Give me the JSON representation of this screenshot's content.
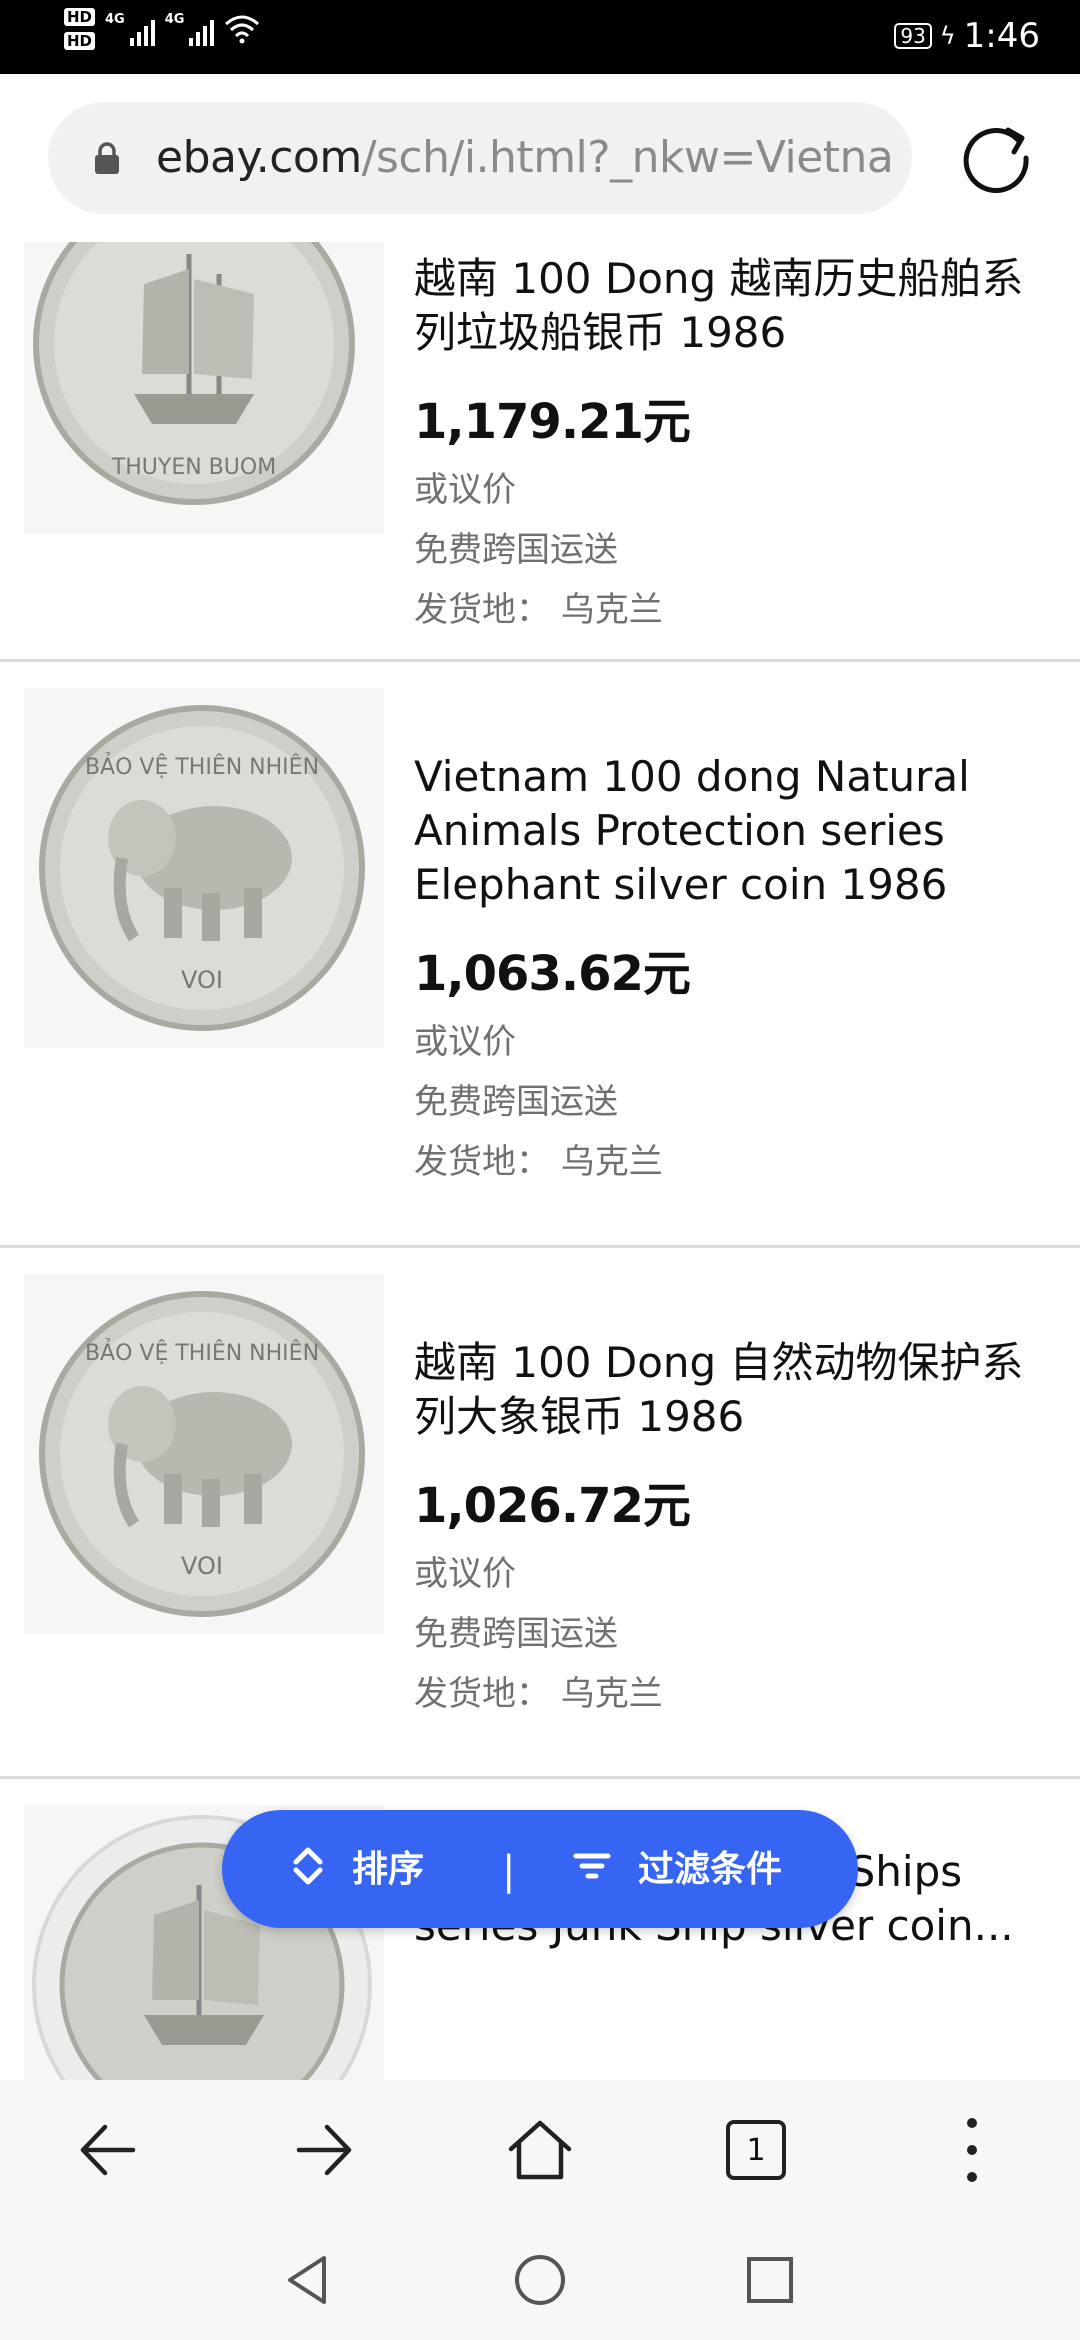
{
  "status_bar": {
    "hd1": "HD",
    "hd2": "HD",
    "net1": "4G",
    "net2": "4G",
    "battery": "93",
    "time": "1:46"
  },
  "url_bar": {
    "domain": "ebay.com",
    "path": "/sch/i.html?_nkw=Vietna"
  },
  "listings": [
    {
      "title": "越南 100 Dong 越南历史船舶系列垃圾船银币 1986",
      "price": "1,179.21元",
      "offer": "或议价",
      "shipping": "免费跨国运送",
      "location": "发货地： 乌克兰",
      "coin_text_top": "",
      "coin_text_bottom": "THUYEN BUOM"
    },
    {
      "title": "Vietnam 100 dong Natural Animals Protection series Elephant silver coin 1986",
      "price": "1,063.62元",
      "offer": "或议价",
      "shipping": "免费跨国运送",
      "location": "发货地： 乌克兰",
      "coin_text_top": "BẢO VỆ THIÊN NHIÊN",
      "coin_text_bottom": "VOI"
    },
    {
      "title": "越南 100 Dong 自然动物保护系列大象银币 1986",
      "price": "1,026.72元",
      "offer": "或议价",
      "shipping": "免费跨国运送",
      "location": "发货地： 乌克兰",
      "coin_text_top": "BẢO VỆ THIÊN NHIÊN",
      "coin_text_bottom": "VOI"
    },
    {
      "title": "Vietnamese Historic Ships series Junk Ship silver coin...",
      "price": "",
      "offer": "",
      "shipping": "",
      "location": "",
      "coin_text_top": "",
      "coin_text_bottom": ""
    }
  ],
  "fab": {
    "sort_label": "排序",
    "separator": "|",
    "filter_label": "过滤条件"
  },
  "toolbar": {
    "tab_count": "1"
  },
  "colors": {
    "accent": "#3665f3"
  }
}
